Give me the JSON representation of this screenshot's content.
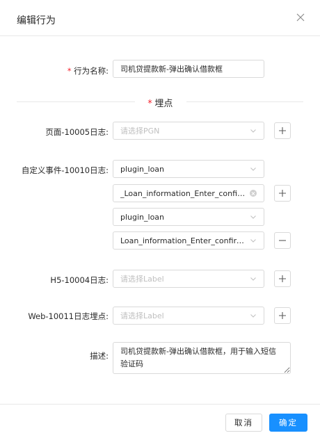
{
  "dialog": {
    "title": "编辑行为",
    "close_icon": "close-icon"
  },
  "form": {
    "required_mark": "*",
    "behavior_name": {
      "label": "行为名称:",
      "value": "司机贷提款新-弹出确认借款框"
    },
    "tracking_section": {
      "title": "埋点"
    },
    "page_log": {
      "label": "页面-10005日志:",
      "placeholder": "请选择PGN"
    },
    "custom_event_log": {
      "label": "自定义事件-10010日志:",
      "rows": [
        {
          "value": "plugin_loan"
        },
        {
          "value": "_Loan_information_Enter_confir..."
        },
        {
          "value": "plugin_loan"
        },
        {
          "value": "Loan_information_Enter_confirm..."
        }
      ]
    },
    "h5_log": {
      "label": "H5-10004日志:",
      "placeholder": "请选择Label"
    },
    "web_log": {
      "label": "Web-10011日志埋点:",
      "placeholder": "请选择Label"
    },
    "description": {
      "label": "描述:",
      "value": "司机贷提款新-弹出确认借款框，用于输入短信验证码"
    }
  },
  "footer": {
    "cancel_label": "取消",
    "ok_label": "确定"
  },
  "colors": {
    "primary": "#1890ff",
    "required": "#f5222d",
    "border": "#d9d9d9",
    "placeholder": "#bfbfbf"
  }
}
